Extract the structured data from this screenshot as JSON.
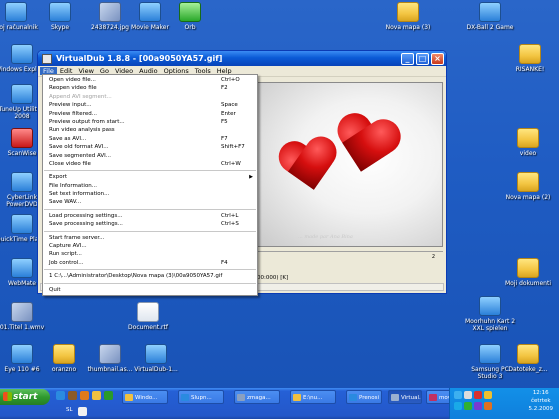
{
  "desktop": {
    "icons": [
      {
        "label": "Moj računalnik",
        "kind": "app"
      },
      {
        "label": "Skype",
        "kind": "app"
      },
      {
        "label": "2438724.jpg",
        "kind": "img"
      },
      {
        "label": "Movie Maker",
        "kind": "app"
      },
      {
        "label": "Orb",
        "kind": "green"
      },
      {
        "label": "Nova mapa (3)",
        "kind": "folder"
      },
      {
        "label": "DX-Ball 2 Game",
        "kind": "app"
      },
      {
        "label": "Windows Explorer",
        "kind": "app"
      },
      {
        "label": "RISANKE!",
        "kind": "folder"
      },
      {
        "label": "TuneUp Utilities 2008",
        "kind": "app"
      },
      {
        "label": "ScanWise",
        "kind": "red"
      },
      {
        "label": "video",
        "kind": "folder"
      },
      {
        "label": "CyberLink PowerDVD",
        "kind": "app"
      },
      {
        "label": "Nova mapa (2)",
        "kind": "folder"
      },
      {
        "label": "QuickTime Player",
        "kind": "app"
      },
      {
        "label": "WebMate",
        "kind": "app"
      },
      {
        "label": "Moji dokumenti",
        "kind": "folder"
      },
      {
        "label": "01.Titel 1.wmv",
        "kind": "img"
      },
      {
        "label": "Document.rtf",
        "kind": "doc"
      },
      {
        "label": "Moorhuhn Kart 2 XXL spielen",
        "kind": "app"
      },
      {
        "label": "Eye 110 #6",
        "kind": "app"
      },
      {
        "label": "oranzno",
        "kind": "folder"
      },
      {
        "label": "thumbnail.as...",
        "kind": "img"
      },
      {
        "label": "VirtualDub-1...",
        "kind": "app"
      },
      {
        "label": "Samsung PC Studio 3",
        "kind": "app"
      },
      {
        "label": "Datoteke_z...",
        "kind": "folder"
      }
    ]
  },
  "window": {
    "title": "VirtualDub 1.8.8 - [00a9050YA57.gif]",
    "menu": [
      "File",
      "Edit",
      "View",
      "Go",
      "Video",
      "Audio",
      "Options",
      "Tools",
      "Help"
    ],
    "active_menu": "File",
    "watermark": "... made par Ana Bina",
    "timeline_tick": "2",
    "status": "00:000) [K]"
  },
  "file_menu": [
    {
      "label": "Open video file...",
      "shortcut": "Ctrl+O"
    },
    {
      "label": "Reopen video file",
      "shortcut": "F2"
    },
    {
      "label": "Append AVI segment...",
      "shortcut": "",
      "disabled": true
    },
    {
      "label": "Preview input...",
      "shortcut": "Space"
    },
    {
      "label": "Preview filtered...",
      "shortcut": "Enter"
    },
    {
      "label": "Preview output from start...",
      "shortcut": "F5"
    },
    {
      "label": "Run video analysis pass",
      "shortcut": ""
    },
    {
      "label": "Save as AVI...",
      "shortcut": "F7"
    },
    {
      "label": "Save old format AVI...",
      "shortcut": "Shift+F7"
    },
    {
      "label": "Save segmented AVI...",
      "shortcut": ""
    },
    {
      "label": "Close video file",
      "shortcut": "Ctrl+W"
    },
    {
      "sep": true
    },
    {
      "label": "Export",
      "shortcut": "",
      "submenu": true
    },
    {
      "label": "File Information...",
      "shortcut": ""
    },
    {
      "label": "Set text information...",
      "shortcut": ""
    },
    {
      "label": "Save WAV...",
      "shortcut": ""
    },
    {
      "sep": true
    },
    {
      "label": "Load processing settings...",
      "shortcut": "Ctrl+L"
    },
    {
      "label": "Save processing settings...",
      "shortcut": "Ctrl+S"
    },
    {
      "sep": true
    },
    {
      "label": "Start frame server...",
      "shortcut": ""
    },
    {
      "label": "Capture AVI...",
      "shortcut": ""
    },
    {
      "label": "Run script...",
      "shortcut": ""
    },
    {
      "label": "Job control...",
      "shortcut": "F4"
    },
    {
      "sep": true
    },
    {
      "label": "1 C:\\...\\Administrator\\Desktop\\Nova mapa (3)\\00a9050YA57.gif",
      "shortcut": ""
    },
    {
      "sep": true
    },
    {
      "label": "Quit",
      "shortcut": ""
    }
  ],
  "taskbar": {
    "start_label": "start",
    "items": [
      {
        "label": "Windo...",
        "active": false
      },
      {
        "label": "Slupn...",
        "active": false
      },
      {
        "label": "zmaga...",
        "active": false
      },
      {
        "label": "E:\\nu...",
        "active": false
      },
      {
        "label": "Prenosi",
        "active": false
      },
      {
        "label": "Virtual...",
        "active": true
      },
      {
        "label": "movie ...",
        "active": false
      }
    ],
    "language": "SL",
    "clock_time": "12:16",
    "clock_day": "četrtek",
    "clock_date": "5.2.2009"
  }
}
